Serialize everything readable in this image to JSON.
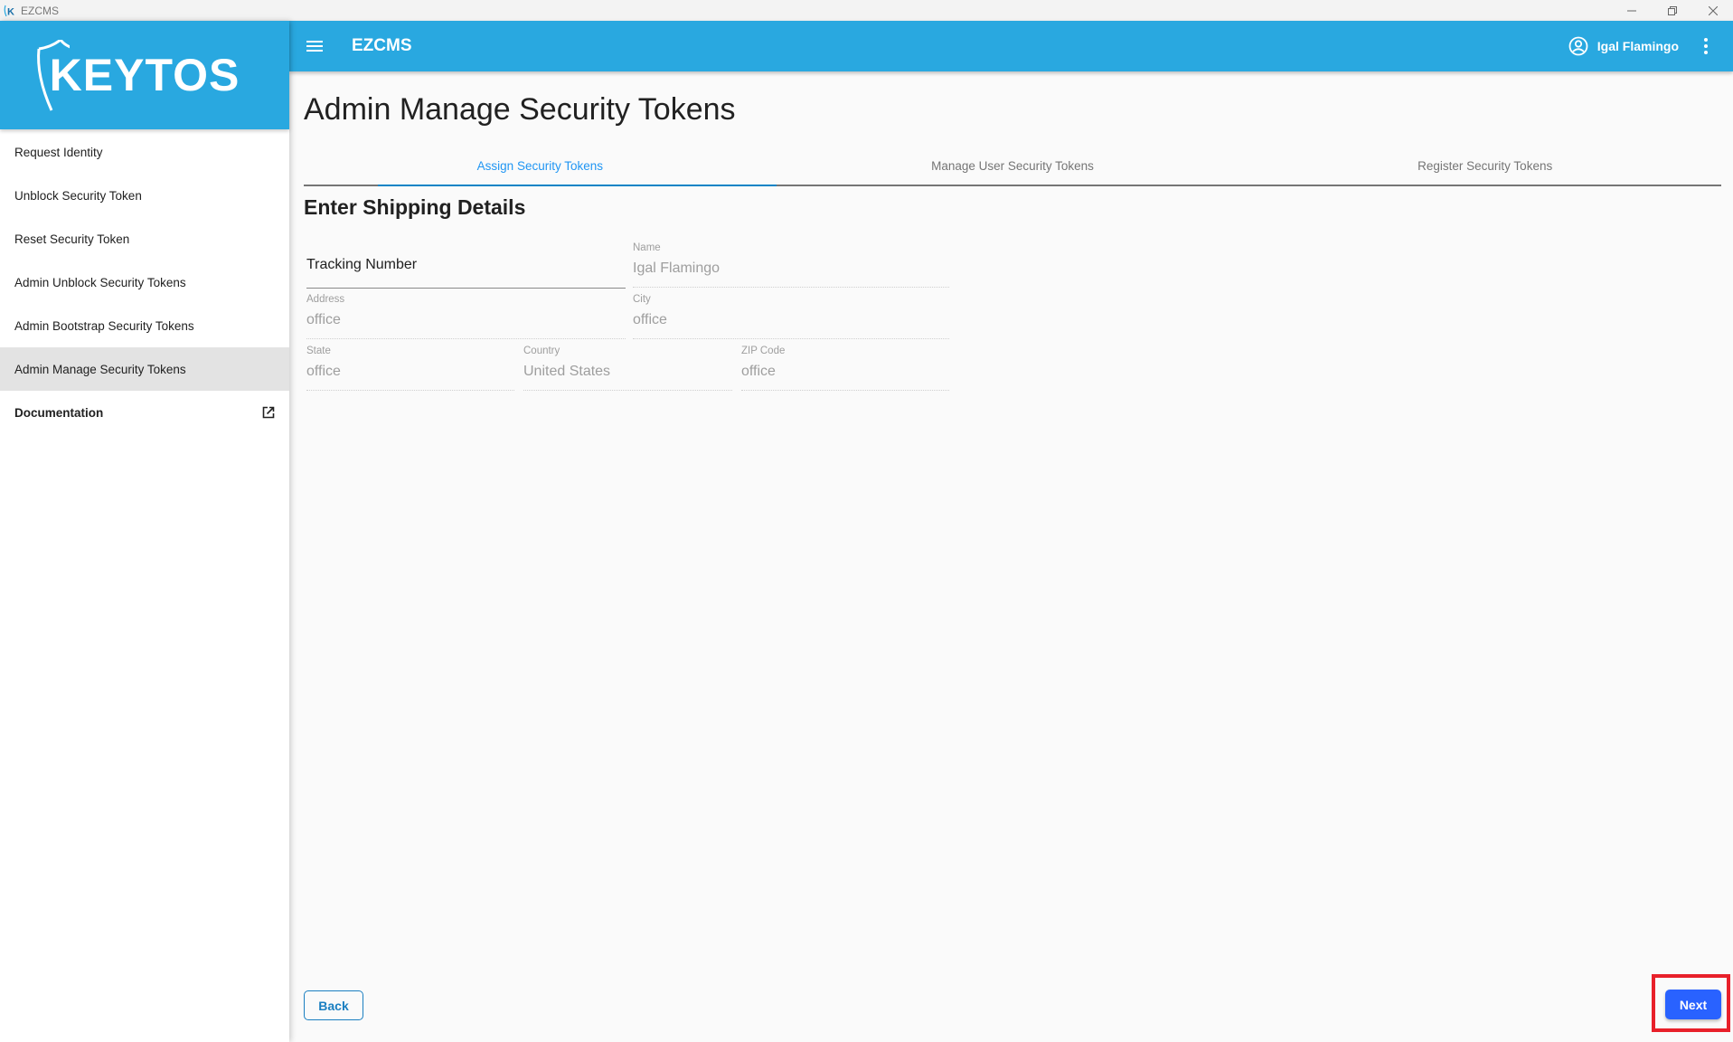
{
  "window": {
    "title": "EZCMS",
    "controls": [
      "minimize",
      "restore",
      "close"
    ]
  },
  "sidebar": {
    "brand": "KEYTOS",
    "items": [
      {
        "label": "Request Identity",
        "active": false
      },
      {
        "label": "Unblock Security Token",
        "active": false
      },
      {
        "label": "Reset Security Token",
        "active": false
      },
      {
        "label": "Admin Unblock Security Tokens",
        "active": false
      },
      {
        "label": "Admin Bootstrap Security Tokens",
        "active": false
      },
      {
        "label": "Admin Manage Security Tokens",
        "active": true
      }
    ],
    "documentation": {
      "label": "Documentation",
      "icon": "open-in-new-icon"
    }
  },
  "appbar": {
    "title": "EZCMS",
    "user_name": "Igal Flamingo",
    "menu_icon": "hamburger-menu-icon",
    "user_icon": "account-circle-icon",
    "more_icon": "more-vertical-icon"
  },
  "main": {
    "page_title": "Admin Manage Security Tokens",
    "tabs": [
      {
        "label": "Assign Security Tokens",
        "active": true
      },
      {
        "label": "Manage User Security Tokens",
        "active": false
      },
      {
        "label": "Register Security Tokens",
        "active": false
      }
    ],
    "section_title": "Enter Shipping Details",
    "form": {
      "tracking_number": {
        "placeholder": "Tracking Number",
        "value": ""
      },
      "name": {
        "label": "Name",
        "value": "Igal Flamingo"
      },
      "address": {
        "label": "Address",
        "value": "office"
      },
      "city": {
        "label": "City",
        "value": "office"
      },
      "state": {
        "label": "State",
        "value": "office"
      },
      "country": {
        "label": "Country",
        "value": "United States"
      },
      "zip": {
        "label": "ZIP Code",
        "value": "office"
      }
    },
    "buttons": {
      "back": "Back",
      "next": "Next"
    }
  },
  "colors": {
    "primary": "#29a8e0",
    "tab_active": "#2196f3",
    "next_button": "#2962ff",
    "highlight": "#e8202a"
  }
}
